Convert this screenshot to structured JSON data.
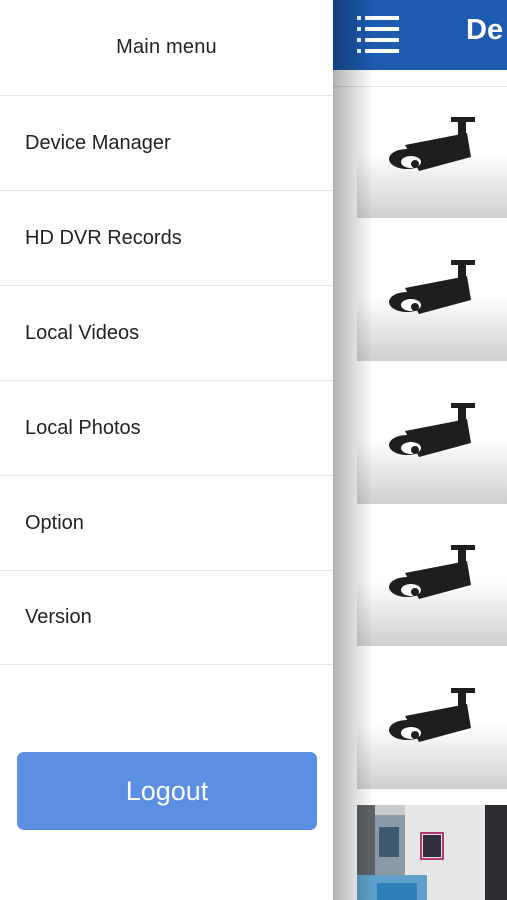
{
  "menu": {
    "title": "Main menu",
    "items": [
      {
        "label": "Device Manager"
      },
      {
        "label": "HD DVR Records"
      },
      {
        "label": "Local Videos"
      },
      {
        "label": "Local Photos"
      },
      {
        "label": "Option"
      },
      {
        "label": "Version"
      }
    ],
    "logout_label": "Logout"
  },
  "main": {
    "title": "De",
    "accent_color": "#1d5bb0",
    "camera_icon": "security-camera-icon",
    "thumbnail_count": 5
  },
  "colors": {
    "logout_button": "#5a8fe3",
    "navbar": "#1d5bb0"
  }
}
